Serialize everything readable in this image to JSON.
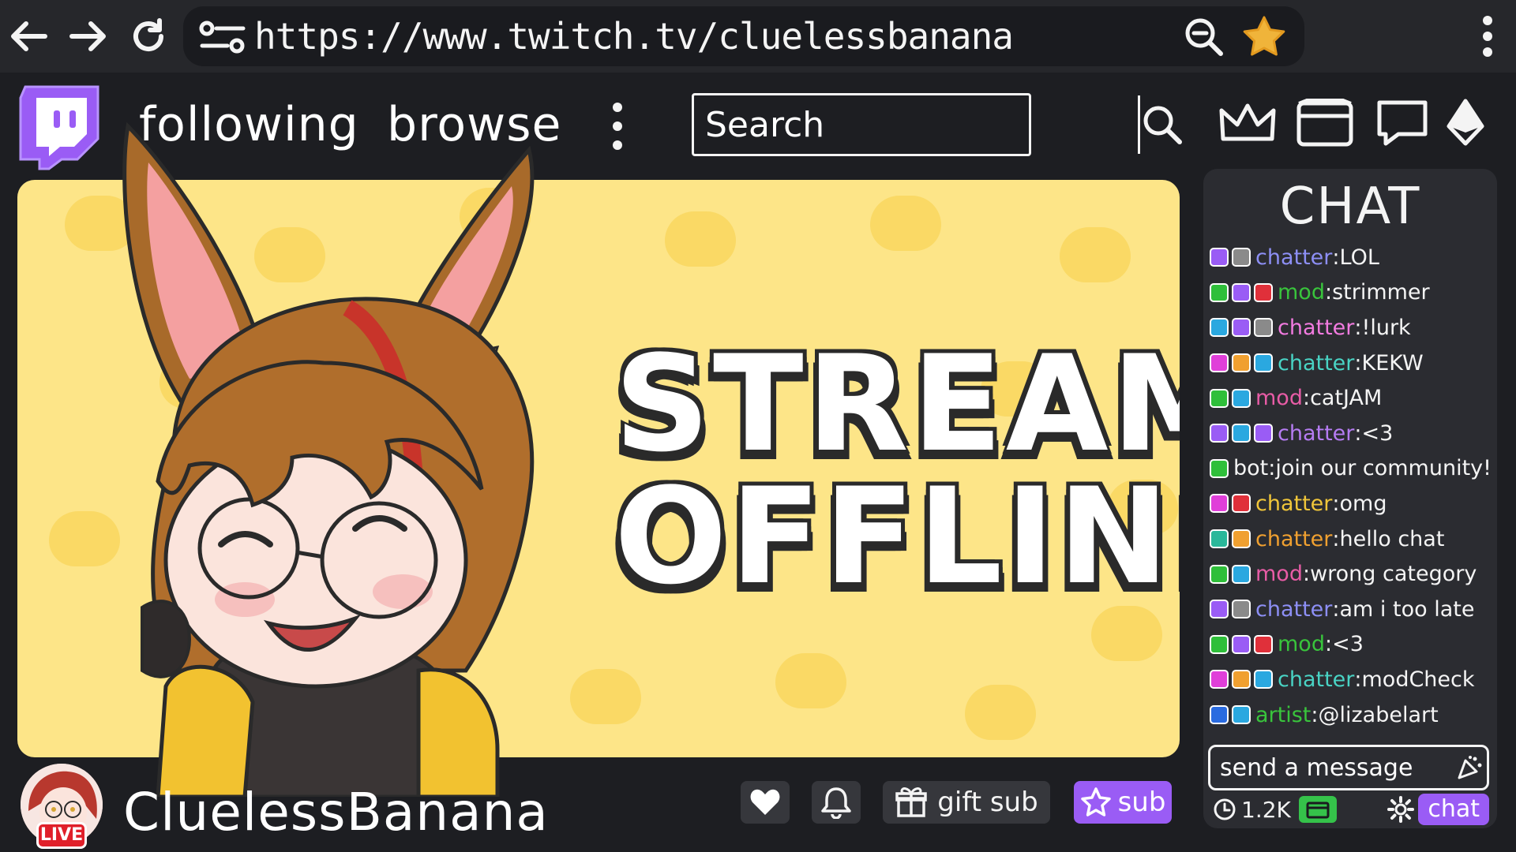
{
  "browser": {
    "url": "https://www.twitch.tv/cluelessbanana"
  },
  "header": {
    "nav": [
      "following",
      "browse"
    ],
    "search_placeholder": "Search"
  },
  "player": {
    "offline_line1": "STREAM",
    "offline_line2": "OFFLINE"
  },
  "chat": {
    "title": "CHAT",
    "messages": [
      {
        "user": "chatter",
        "text": "LOL",
        "color": "#8d8ff5",
        "badges": [
          "#9a5cf5",
          "#8a8a8a"
        ]
      },
      {
        "user": "mod",
        "text": "strimmer",
        "color": "#39c43c",
        "badges": [
          "#2fbf3a",
          "#9a5cf5",
          "#e0303a"
        ]
      },
      {
        "user": "chatter",
        "text": "!lurk",
        "color": "#f27be0",
        "badges": [
          "#2aa8e0",
          "#9a5cf5",
          "#8a8a8a"
        ]
      },
      {
        "user": "chatter",
        "text": "KEKW",
        "color": "#49d3c4",
        "badges": [
          "#e03fd9",
          "#f0a030",
          "#2aa8e0"
        ]
      },
      {
        "user": "mod",
        "text": "catJAM",
        "color": "#e85ca6",
        "badges": [
          "#2fbf3a",
          "#2aa8e0"
        ]
      },
      {
        "user": "chatter",
        "text": "<3",
        "color": "#b57cf2",
        "badges": [
          "#9a5cf5",
          "#2aa8e0",
          "#9a5cf5"
        ]
      },
      {
        "user": "bot",
        "text": "join our community!",
        "color": "#f4f4f4",
        "badges": [
          "#2fbf3a"
        ]
      },
      {
        "user": "chatter",
        "text": "omg",
        "color": "#f0c63a",
        "badges": [
          "#e03fd9",
          "#e0303a"
        ]
      },
      {
        "user": "chatter",
        "text": "hello chat",
        "color": "#f0a030",
        "badges": [
          "#2ab89a",
          "#f0a030"
        ]
      },
      {
        "user": "mod",
        "text": "wrong category",
        "color": "#e85ca6",
        "badges": [
          "#2fbf3a",
          "#2aa8e0"
        ]
      },
      {
        "user": "chatter",
        "text": "am i too late",
        "color": "#8d8ff5",
        "badges": [
          "#9a5cf5",
          "#8a8a8a"
        ]
      },
      {
        "user": "mod",
        "text": "<3",
        "color": "#39c43c",
        "badges": [
          "#2fbf3a",
          "#9a5cf5",
          "#e0303a"
        ]
      },
      {
        "user": "chatter",
        "text": "modCheck",
        "color": "#49d3c4",
        "badges": [
          "#e03fd9",
          "#f0a030",
          "#2aa8e0"
        ]
      },
      {
        "user": "artist",
        "text": "@lizabelart",
        "color": "#39c43c",
        "badges": [
          "#2a6be0",
          "#2aa8e0"
        ]
      }
    ],
    "input_placeholder": "send a message",
    "viewer_count": "1.2K",
    "chat_button": "chat"
  },
  "channel": {
    "name": "CluelessBanana",
    "live_label": "LIVE",
    "gift_label": "gift sub",
    "sub_label": "sub"
  },
  "colors": {
    "accent": "#9a5cf5",
    "player_bg": "#fde588",
    "live_red": "#e0202a"
  }
}
